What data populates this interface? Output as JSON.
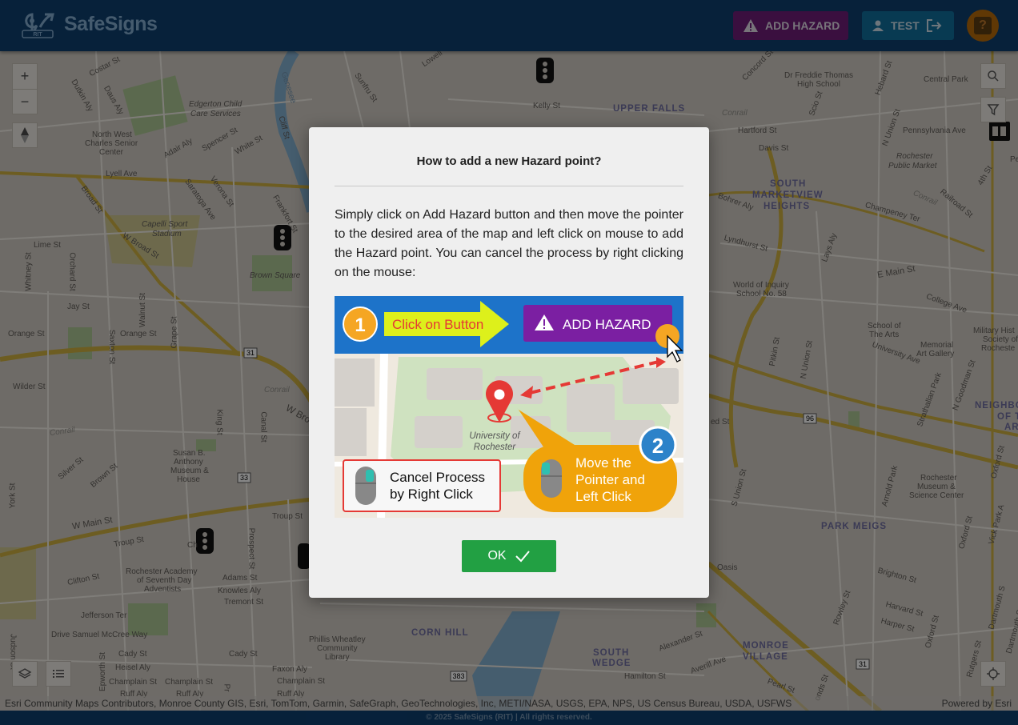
{
  "header": {
    "logo_badge": "RIT",
    "app_name": "SafeSigns",
    "add_hazard_label": "ADD HAZARD",
    "user_label": "TEST",
    "help_icon": "help-icon"
  },
  "map": {
    "labels": {
      "costar": "Costar St",
      "dutkin": "Dutkin Aly",
      "daus": "Daus Aly",
      "edgerton": "Edgerton Child",
      "edgerton2": "Care Services",
      "northwest1": "North West",
      "northwest2": "Charles Senior",
      "northwest3": "Center",
      "adair": "Adair Aly",
      "spencer": "Spencer St",
      "white": "White St",
      "cliff": "Cliff St",
      "lyell": "Lyell Ave",
      "broad": "Broad St",
      "saratoga": "Saratoga Ave",
      "verona": "Verona St",
      "frankfort": "Frankfort St",
      "capelli1": "Capelli Sport",
      "capelli2": "Stadium",
      "wbroad": "W Broad St",
      "lime": "Lime St",
      "whitney": "Whitney St",
      "orchard": "Orchard St",
      "brownsq": "Brown Square",
      "jay": "Jay St",
      "orange1": "Orange St",
      "saxton": "Saxton St",
      "orange2": "Orange St",
      "walnut": "Walnut St",
      "grape": "Grape St",
      "wilder": "Wilder St",
      "conrail1": "Conrail",
      "conrail2": "Conrail",
      "king": "King St",
      "canal": "Canal St",
      "wbro": "W Bro",
      "silver": "Silver St",
      "brown": "Brown St",
      "susan1": "Susan B.",
      "susan2": "Anthony",
      "susan3": "Museum &",
      "susan4": "House",
      "york": "York St",
      "wmain": "W Main St",
      "troup1": "Troup St",
      "troup2": "Troup St",
      "prospect": "Prospect St",
      "academy1": "Rochester Academy",
      "academy2": "of Seventh Day",
      "academy3": "Adventists",
      "clifton": "Clifton St",
      "adams": "Adams St",
      "knowles": "Knowles Aly",
      "tremont": "Tremont St",
      "jefferson": "Jefferson Ter",
      "mccree": "Drive Samuel McCree Way",
      "cady1": "Cady St",
      "cady2": "Cady St",
      "heisel": "Heisel Aly",
      "champlain1": "Champlain St",
      "champlain2": "Champlain St",
      "champlain3": "Champlain St",
      "ruff1": "Ruff Aly",
      "ruff2": "Ruff Aly",
      "ruff3": "Ruff Aly",
      "faxon": "Faxon Aly",
      "wheatley1": "Phillis Wheatley",
      "wheatley2": "Community",
      "wheatley3": "Library",
      "cornhill": "CORN HILL",
      "epworth": "Epworth St",
      "judson": "Judson St",
      "genesee": "Genesee",
      "sunfru": "Sunfru St",
      "lowell": "Lowell",
      "kelly": "Kelly St",
      "upperfalls": "UPPER FALLS",
      "concord": "Concord St",
      "freddie1": "Dr Freddie Thomas",
      "freddie2": "High School",
      "hebard": "Hebard St",
      "central": "Central Park",
      "conrail3": "Conrail",
      "hartford": "Hartford St",
      "scio": "Scio St",
      "nunion1": "N Union St",
      "pennsylvania": "Pennsylvania Ave",
      "davis": "Davis St",
      "rpm1": "Rochester",
      "rpm2": "Public Market",
      "south1": "SOUTH",
      "south2": "MARKETVIEW",
      "south3": "HEIGHTS",
      "bohrer": "Bohrer Aly",
      "champeney": "Champeney Ter",
      "conrail4": "Conrail",
      "railroad": "Railroad St",
      "fourth": "4th St",
      "pe": "Pe",
      "lyndhurst": "Lyndhurst St",
      "lays": "Lays Aly",
      "emain": "E Main St",
      "wis1": "World of Inquiry",
      "wis2": "School No. 58",
      "college": "College Ave",
      "sota1": "School of",
      "sota2": "The Arts",
      "university": "University Ave",
      "memorial1": "Memorial",
      "memorial2": "Art Gallery",
      "military1": "Military Hist",
      "military2": "Society of",
      "military3": "Rocheste",
      "pitkin": "Pitkin St",
      "nunion2": "N Union St",
      "strathallan": "Strathallan Park",
      "ngoodman": "N Goodman St",
      "neighb1": "NEIGHBO",
      "neighb2": "OF T",
      "neighb3": "AR",
      "ed": "ed St",
      "sunion": "S Union St",
      "arnold": "Arnold Park",
      "rmsc1": "Rochester",
      "rmsc2": "Museum &",
      "rmsc3": "Science Center",
      "oxford1": "Oxford St",
      "vick": "Vick Park A",
      "oxford2": "Oxford St",
      "parkmeigs": "PARK MEIGS",
      "oasis": "Oasis",
      "brighton": "Brighton St",
      "rowley": "Rowley St",
      "harvard": "Harvard St",
      "harper": "Harper St",
      "oxford3": "Oxford St",
      "rutgers": "Rutgers St",
      "dartmouth1": "Dartmouth S",
      "dartmouth2": "Dartmouth S",
      "monroe1": "MONROE",
      "monroe2": "VILLAGE",
      "alexander": "Alexander St",
      "averill": "Averill Ave",
      "hamilton": "Hamilton St",
      "southwedge1": "SOUTH",
      "southwedge2": "WEDGE",
      "pearl": "Pearl St",
      "onds": "onds St",
      "pr": "Pr",
      "ch": "Ch"
    },
    "shields": [
      "31",
      "33",
      "96",
      "31",
      "383"
    ],
    "controls": {
      "zoom_in": "+",
      "zoom_out": "−"
    },
    "attribution": "Esri Community Maps Contributors, Monroe County GIS, Esri, TomTom, Garmin, SafeGraph, GeoTechnologies, Inc, METI/NASA, USGS, EPA, NPS, US Census Bureau, USDA, USFWS",
    "powered_by": "Powered by Esri"
  },
  "modal": {
    "title": "How to add a new Hazard point?",
    "body": "Simply click on Add Hazard button and then move the pointer to the desired area of the map and left click on mouse to add the Hazard point. You can cancel the process by right clicking on the mouse:",
    "ok_label": "OK",
    "illustration": {
      "step1_number": "1",
      "step1_text": "Click on Button",
      "button_text": "ADD HAZARD",
      "place_label_1": "University of",
      "place_label_2": "Rochester",
      "cancel_line1": "Cancel Process",
      "cancel_line2": "by Right Click",
      "step2_number": "2",
      "move_line1": "Move the",
      "move_line2": "Pointer and",
      "move_line3": "Left Click"
    }
  },
  "footer": {
    "text": "© 2025 SafeSigns (RIT) | All rights reserved."
  },
  "colors": {
    "header_bg": "#0d3c6b",
    "add_hazard_bg": "#7b1fa2",
    "user_btn_bg": "#0288d1",
    "help_btn_bg": "#f57c00",
    "ok_btn_bg": "#28a745"
  }
}
